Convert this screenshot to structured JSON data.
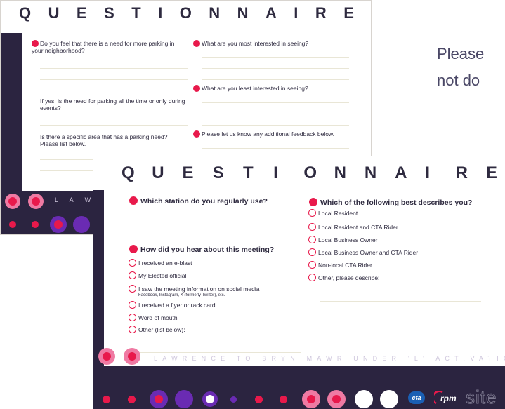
{
  "colors": {
    "navy": "#2b2440",
    "red": "#e8194b",
    "pink": "#ef7aa3",
    "purple": "#6a2bb3",
    "white": "#ffffff"
  },
  "back_sheet": {
    "title_letters": [
      "Q",
      "U",
      "E",
      "S",
      "T",
      "I",
      "O",
      "N",
      "N",
      "A",
      "I",
      "R",
      "E"
    ],
    "q1": "Do you feel that there is a need for more parking in your neighborhood?",
    "q2": "If yes, is the need for parking all the time or only during events?",
    "q3": "Is there a specific area that has a parking need? Please list below.",
    "q4": "What are you most interested in seeing?",
    "q5": "What are you least interested in seeing?",
    "q6": "Please let us know any additional feedback below.",
    "band_label": "L A W R E N"
  },
  "side_text": {
    "line1": "Please",
    "line2": "not do"
  },
  "front_sheet": {
    "title_letters": [
      "Q",
      "U",
      "E",
      "S",
      "T",
      "I",
      "O",
      "N",
      "N",
      "A",
      "I",
      "R",
      "E"
    ],
    "station_question": "Which station do you regularly use?",
    "hear_question": "How did you hear about this meeting?",
    "hear_options": [
      {
        "label": "I received an e-blast",
        "sub": ""
      },
      {
        "label": "My Elected official",
        "sub": ""
      },
      {
        "label": "I saw the meeting information on social media",
        "sub": "Facebook, Instagram, X (formerly Twitter), etc."
      },
      {
        "label": "I received a flyer or rack card",
        "sub": ""
      },
      {
        "label": "Word of mouth",
        "sub": ""
      },
      {
        "label": "Other (list below):",
        "sub": ""
      }
    ],
    "describe_question": "Which of the following best describes you?",
    "describe_options": [
      "Local Resident",
      "Local Resident and CTA Rider",
      "Local Business Owner",
      "Local Business Owner and CTA Rider",
      "Non-local CTA Rider",
      "Other, please describe:"
    ],
    "band_label": "LAWRENCE TO BRYN MAWR UNDER 'L' ACTIVATION",
    "logos": {
      "cta": "cta",
      "rpm": "rpm",
      "site": "site"
    }
  }
}
